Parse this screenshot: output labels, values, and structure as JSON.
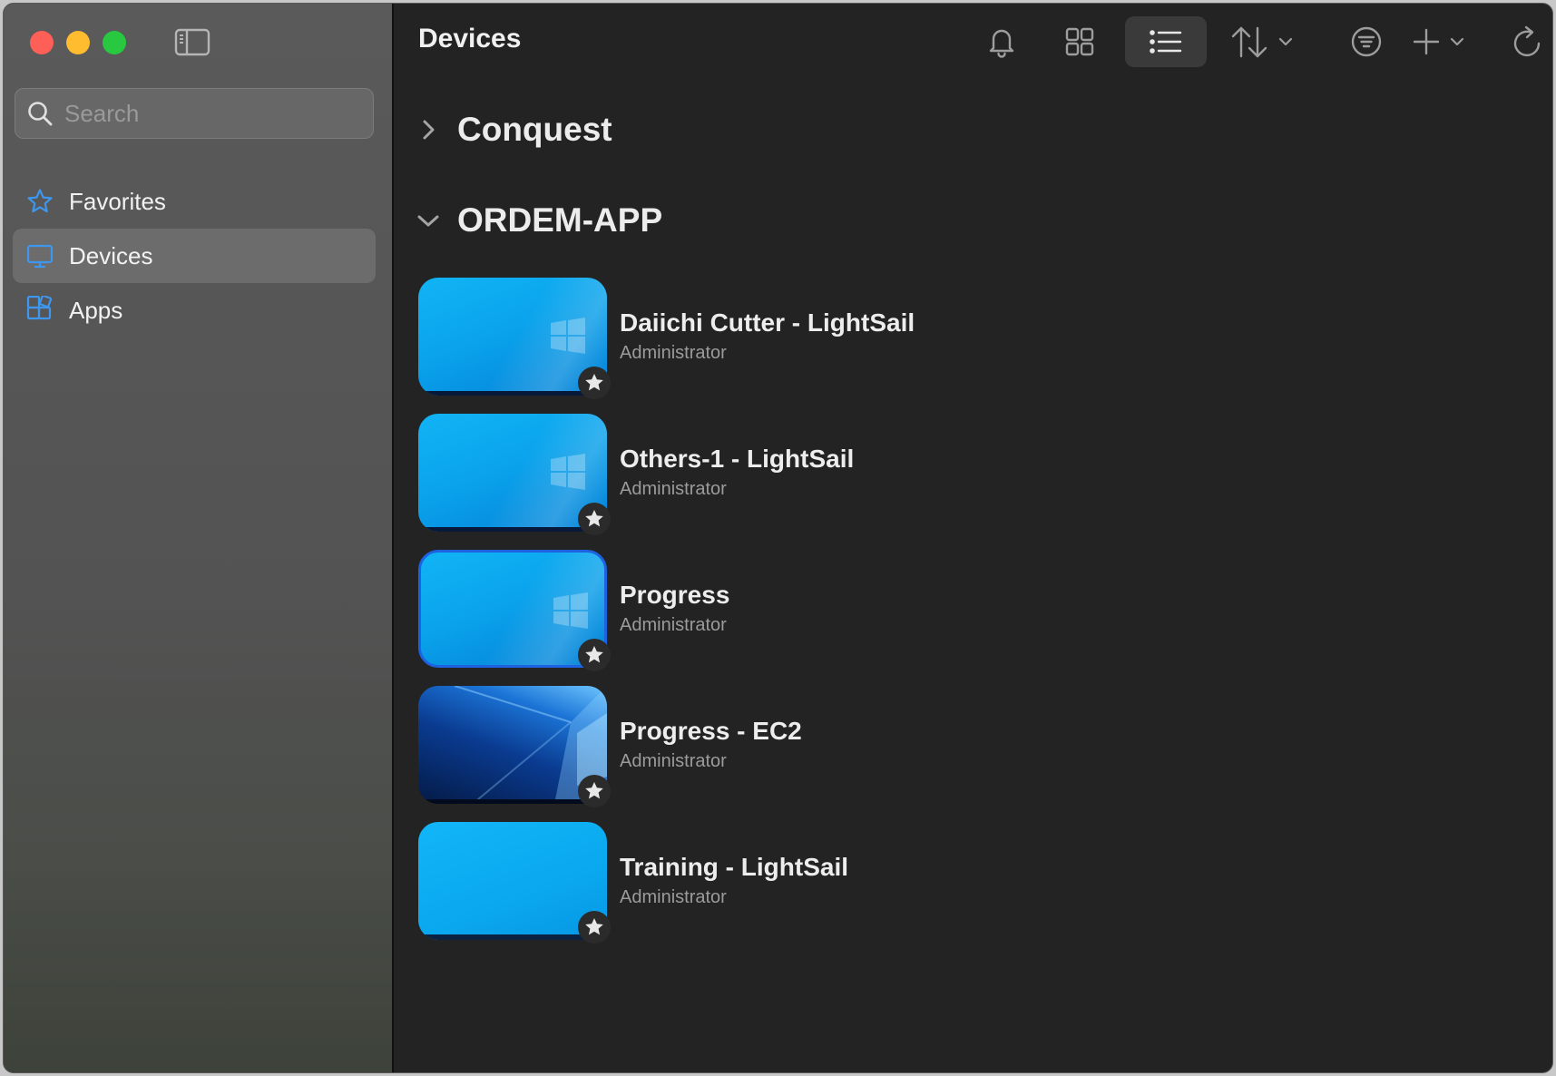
{
  "window": {
    "traffic_lights": [
      "close",
      "minimize",
      "zoom"
    ]
  },
  "sidebar": {
    "search": {
      "placeholder": "Search",
      "value": ""
    },
    "items": [
      {
        "label": "Favorites",
        "icon": "star-icon",
        "active": false
      },
      {
        "label": "Devices",
        "icon": "monitor-icon",
        "active": true
      },
      {
        "label": "Apps",
        "icon": "apps-icon",
        "active": false
      }
    ]
  },
  "header": {
    "title": "Devices",
    "toolbar": [
      "bell-icon",
      "grid-view-icon",
      "list-view-icon",
      "sort-icon",
      "filter-icon",
      "add-icon",
      "refresh-icon"
    ],
    "selected_view": "list"
  },
  "groups": [
    {
      "label": "Conquest",
      "expanded": false
    },
    {
      "label": "ORDEM-APP",
      "expanded": true
    }
  ],
  "devices": [
    {
      "name": "Daiichi Cutter - LightSail",
      "role": "Administrator",
      "favorite": true
    },
    {
      "name": "Others-1 - LightSail",
      "role": "Administrator",
      "favorite": true
    },
    {
      "name": "Progress",
      "role": "Administrator",
      "favorite": true
    },
    {
      "name": "Progress - EC2",
      "role": "Administrator",
      "favorite": true
    },
    {
      "name": "Training - LightSail",
      "role": "Administrator",
      "favorite": true
    }
  ],
  "colors": {
    "accent": "#2f8ee8",
    "background": "#232323",
    "sidebar": "#555555"
  }
}
